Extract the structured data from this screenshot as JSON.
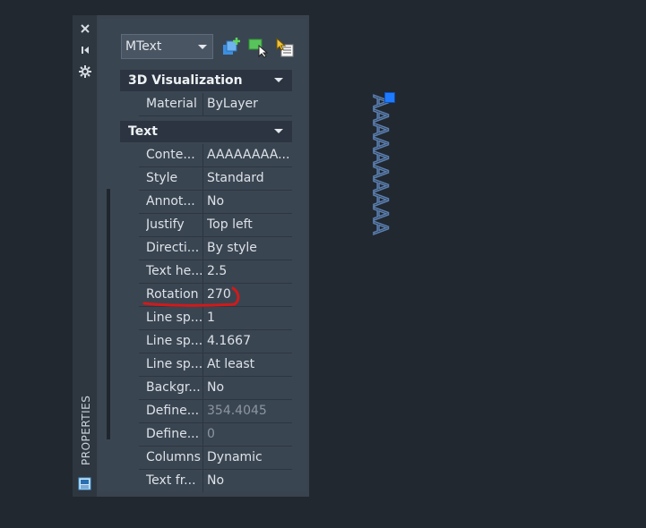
{
  "palette": {
    "title": "PROPERTIES",
    "strip_icons": [
      "close-icon",
      "auto-hide-icon",
      "settings-icon"
    ],
    "object_type": "MText",
    "toolbar": [
      "quick-select-icon",
      "select-objects-icon",
      "toggle-pickadd-icon"
    ]
  },
  "sections": [
    {
      "title": "3D Visualization",
      "rows": [
        {
          "label": "Material",
          "value": "ByLayer"
        }
      ]
    },
    {
      "title": "Text",
      "rows": [
        {
          "label": "Conte...",
          "value": "AAAAAAAA..."
        },
        {
          "label": "Style",
          "value": "Standard"
        },
        {
          "label": "Annot...",
          "value": "No"
        },
        {
          "label": "Justify",
          "value": "Top left"
        },
        {
          "label": "Directi...",
          "value": "By style"
        },
        {
          "label": "Text he...",
          "value": "2.5"
        },
        {
          "label": "Rotation",
          "value": "270"
        },
        {
          "label": "Line sp...",
          "value": "1"
        },
        {
          "label": "Line sp...",
          "value": "4.1667"
        },
        {
          "label": "Line sp...",
          "value": "At least"
        },
        {
          "label": "Backgr...",
          "value": "No"
        },
        {
          "label": "Define...",
          "value": "354.4045"
        },
        {
          "label": "Define...",
          "value": "0"
        },
        {
          "label": "Columns",
          "value": "Dynamic"
        },
        {
          "label": "Text fr...",
          "value": "No"
        }
      ]
    }
  ],
  "canvas": {
    "mtext_content": "AAAAAAAAAA",
    "grip_color": "#1e7bff"
  },
  "colors": {
    "annotation": "#d11a1a"
  }
}
